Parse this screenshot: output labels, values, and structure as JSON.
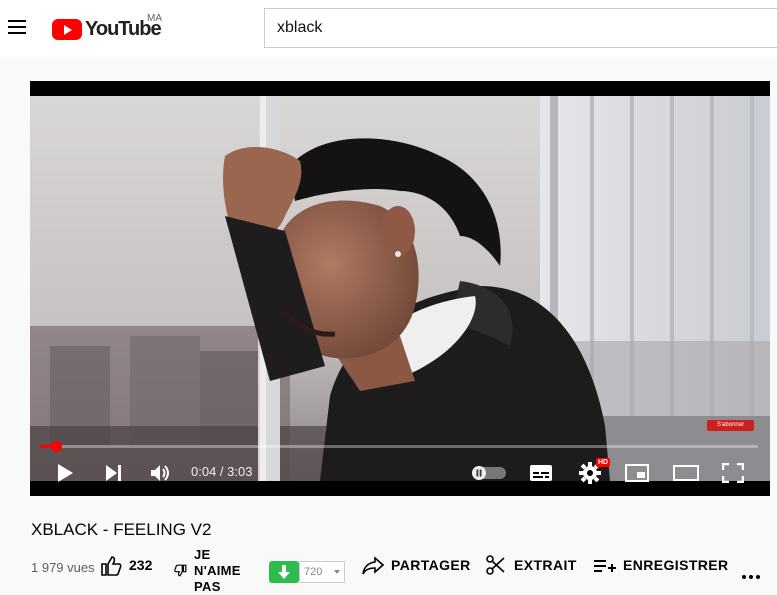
{
  "header": {
    "logo_text": "YouTube",
    "country_code": "MA",
    "search_value": "xblack"
  },
  "player": {
    "current_time": "0:04",
    "time_separator": " / ",
    "duration": "3:03",
    "progress": 0.022,
    "hd_badge": "HD",
    "subscribe_badge": "S'abonner"
  },
  "video": {
    "title": "XBLACK - FEELING V2",
    "views": "1 979 vues",
    "likes": "232",
    "dislike_label": "JE N'AIME PAS",
    "download_quality": "720",
    "share_label": "PARTAGER",
    "clip_label": "EXTRAIT",
    "save_label": "ENREGISTRER"
  },
  "icons": {
    "menu": "menu-icon",
    "play": "play-icon",
    "next": "skip-next-icon",
    "volume": "volume-icon",
    "autoplay": "autoplay-toggle-icon",
    "subtitles": "subtitles-icon",
    "settings": "gear-icon",
    "miniplayer": "miniplayer-icon",
    "theater": "theater-icon",
    "fullscreen": "fullscreen-icon",
    "like": "thumb-up-icon",
    "dislike": "thumb-down-icon",
    "download": "download-arrow-icon",
    "share": "share-arrow-icon",
    "clip": "scissors-icon",
    "save": "playlist-add-icon",
    "more": "more-horiz-icon"
  },
  "colors": {
    "brand_red": "#ff0000",
    "download_green": "#2dbd4f",
    "background": "#f9f9f9"
  }
}
